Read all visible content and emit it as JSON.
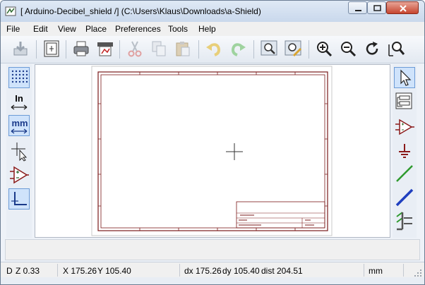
{
  "window": {
    "title": "[ Arduino-Decibel_shield /] (C:\\Users\\Klaus\\Downloads\\a-Shield)"
  },
  "menu": {
    "items": [
      "File",
      "Edit",
      "View",
      "Place",
      "Preferences",
      "Tools",
      "Help"
    ]
  },
  "toolbar": {
    "icons": [
      "new-sheet-icon",
      "page-settings-icon",
      "print-icon",
      "plot-icon",
      "cut-icon",
      "copy-icon",
      "paste-icon",
      "undo-icon",
      "redo-icon",
      "find-icon",
      "find-replace-icon",
      "zoom-in-icon",
      "zoom-out-icon",
      "redraw-icon",
      "zoom-fit-icon"
    ]
  },
  "left_toolbar": {
    "inch_label": "In",
    "mm_label": "mm"
  },
  "status": {
    "zoom": "Z 0.33",
    "zoom_prefix": "D",
    "x": "X 175.26",
    "y": "Y 105.40",
    "dx": "dx 175.26",
    "dy": "dy 105.40",
    "dist": "dist 204.51",
    "units": "mm"
  },
  "colors": {
    "sheet_border": "#7a1a1a",
    "accent_active": "#cfe3fb",
    "green_wire": "#2e9a2e",
    "blue_bus": "#1f3fbf"
  }
}
